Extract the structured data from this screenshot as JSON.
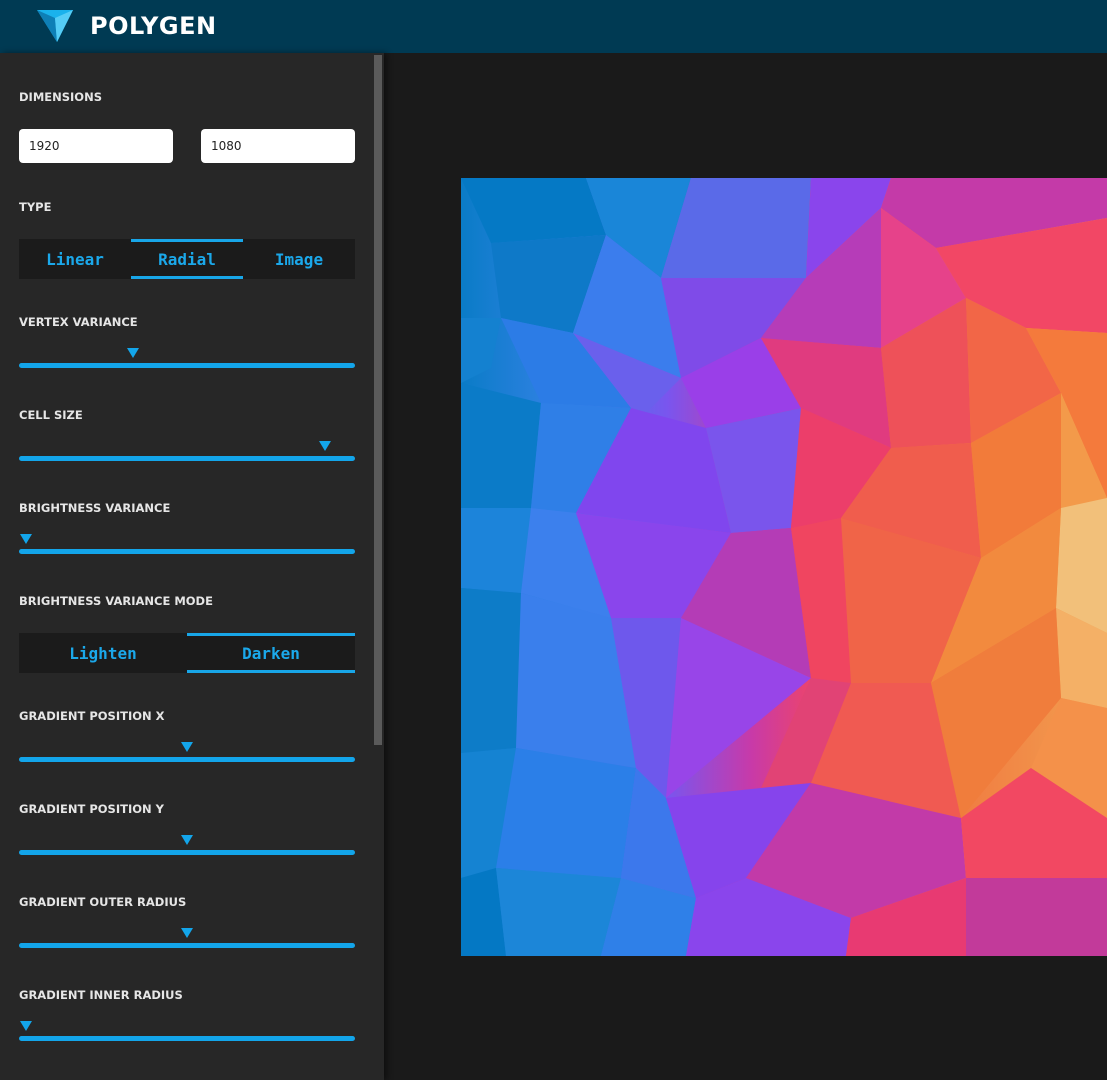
{
  "app": {
    "title": "POLYGEN",
    "logo_icon": "triangle-logo-icon"
  },
  "sidebar": {
    "dimensions_label": "DIMENSIONS",
    "width_value": "1920",
    "height_value": "1080",
    "type_label": "TYPE",
    "type_options": [
      "Linear",
      "Radial",
      "Image"
    ],
    "type_selected": "Radial",
    "vertex_variance": {
      "label": "VERTEX VARIANCE",
      "value_fraction": 0.34
    },
    "cell_size": {
      "label": "CELL SIZE",
      "value_fraction": 0.91
    },
    "brightness_variance": {
      "label": "BRIGHTNESS VARIANCE",
      "value_fraction": 0.02
    },
    "brightness_variance_mode_label": "BRIGHTNESS VARIANCE MODE",
    "mode_options": [
      "Lighten",
      "Darken"
    ],
    "mode_selected": "Darken",
    "gradient_position_x": {
      "label": "GRADIENT POSITION X",
      "value_fraction": 0.5
    },
    "gradient_position_y": {
      "label": "GRADIENT POSITION Y",
      "value_fraction": 0.5
    },
    "gradient_outer_radius": {
      "label": "GRADIENT OUTER RADIUS",
      "value_fraction": 0.5
    },
    "gradient_inner_radius": {
      "label": "GRADIENT INNER RADIUS",
      "value_fraction": 0.02
    }
  },
  "colors": {
    "header_bg": "#003a53",
    "sidebar_bg": "#272727",
    "accent": "#13a5ea",
    "canvas_bg": "#1a1a1a"
  }
}
